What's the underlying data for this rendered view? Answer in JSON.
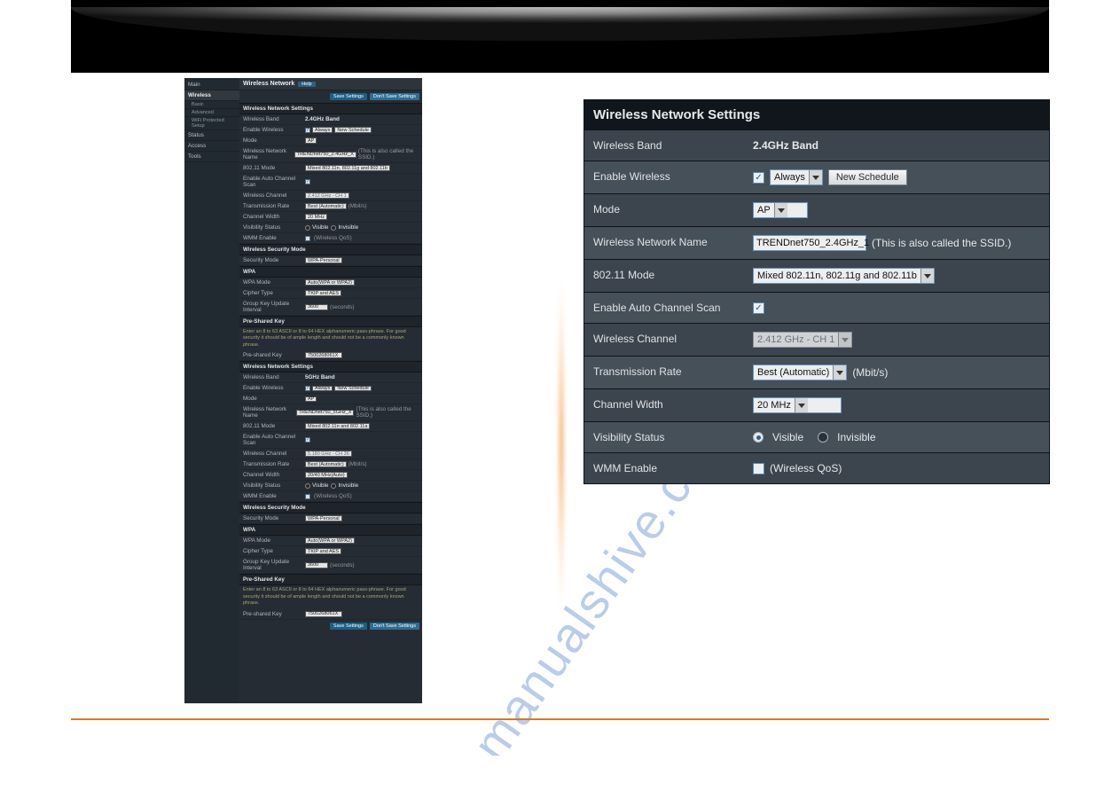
{
  "watermark_text": "manualshive.com",
  "admin": {
    "nav": {
      "main": "Main",
      "wireless": "Wireless",
      "basic": "Basic",
      "advanced": "Advanced",
      "wps": "WiFi Protected Setup",
      "status": "Status",
      "access": "Access",
      "tools": "Tools"
    },
    "title": "Wireless Network",
    "help": "Help",
    "btn_save": "Save Settings",
    "btn_dont": "Don't Save Settings",
    "sec_wns": "Wireless Network Settings",
    "band24": {
      "band_label": "Wireless Band",
      "band_value": "2.4GHz Band",
      "enable_label": "Enable Wireless",
      "enable_sched": "Always",
      "new_sched": "New Schedule",
      "mode_label": "Mode",
      "mode_value": "AP",
      "name_label": "Wireless Network Name",
      "name_value": "TRENDnet750_2.4GHz_X",
      "name_hint": "(This is also called the SSID.)",
      "m80211_label": "802.11 Mode",
      "m80211_value": "Mixed 802.11n, 802.11g and 802.11b",
      "autoch_label": "Enable Auto Channel Scan",
      "wch_label": "Wireless Channel",
      "wch_value": "2.412 GHz - CH 1",
      "txrate_label": "Transmission Rate",
      "txrate_value": "Best (Automatic)",
      "txrate_unit": "(Mbit/s)",
      "cw_label": "Channel Width",
      "cw_value": "20 MHz",
      "vis_label": "Visibility Status",
      "vis_visible": "Visible",
      "vis_invisible": "Invisible",
      "wmm_label": "WMM Enable",
      "wmm_hint": "(Wireless QoS)"
    },
    "sec_wsm": "Wireless Security Mode",
    "wsm": {
      "secmode_label": "Security Mode",
      "secmode_value": "WPA-Personal"
    },
    "sec_wpa": "WPA",
    "wpa": {
      "mode_label": "WPA Mode",
      "mode_value": "Auto(WPA or WPA2)",
      "cipher_label": "Cipher Type",
      "cipher_value": "TKIP and AES",
      "gku_label": "Group Key Update Interval",
      "gku_value": "3600",
      "gku_unit": "(seconds)"
    },
    "sec_psk": "Pre-Shared Key",
    "psk_note": "Enter an 8 to 63 ASCII or 8 to 64 HEX alphanumeric pass-phrase. For good security it should be of ample length and should not be a commonly known phrase.",
    "psk_label": "Pre-shared Key",
    "psk_value": "7500268061X",
    "band5": {
      "band_value": "5GHz Band",
      "name_value": "TRENDnet750_5GHz_X",
      "m80211_value": "Mixed 802.11n and 802.11a",
      "wch_value": "5.180 GHz - CH 36",
      "txrate_unit": "(Mbit/s)",
      "cw_value": "20/40 MHz(Auto)"
    }
  },
  "zoom": {
    "title": "Wireless Network Settings",
    "rows": {
      "band_label": "Wireless Band",
      "band_value": "2.4GHz Band",
      "enable_label": "Enable Wireless",
      "enable_select": "Always",
      "new_schedule": "New Schedule",
      "mode_label": "Mode",
      "mode_value": "AP",
      "name_label": "Wireless Network Name",
      "name_value": "TRENDnet750_2.4GHz_1",
      "name_hint": "(This is also called the SSID.)",
      "m80211_label": "802.11 Mode",
      "m80211_value": "Mixed 802.11n, 802.11g and 802.11b",
      "autoch_label": "Enable Auto Channel Scan",
      "wch_label": "Wireless Channel",
      "wch_value": "2.412 GHz - CH 1",
      "txrate_label": "Transmission Rate",
      "txrate_value": "Best (Automatic)",
      "txrate_unit": "(Mbit/s)",
      "cw_label": "Channel Width",
      "cw_value": "20 MHz",
      "vis_label": "Visibility Status",
      "vis_visible": "Visible",
      "vis_invisible": "Invisible",
      "wmm_label": "WMM Enable",
      "wmm_hint": "(Wireless QoS)"
    }
  }
}
